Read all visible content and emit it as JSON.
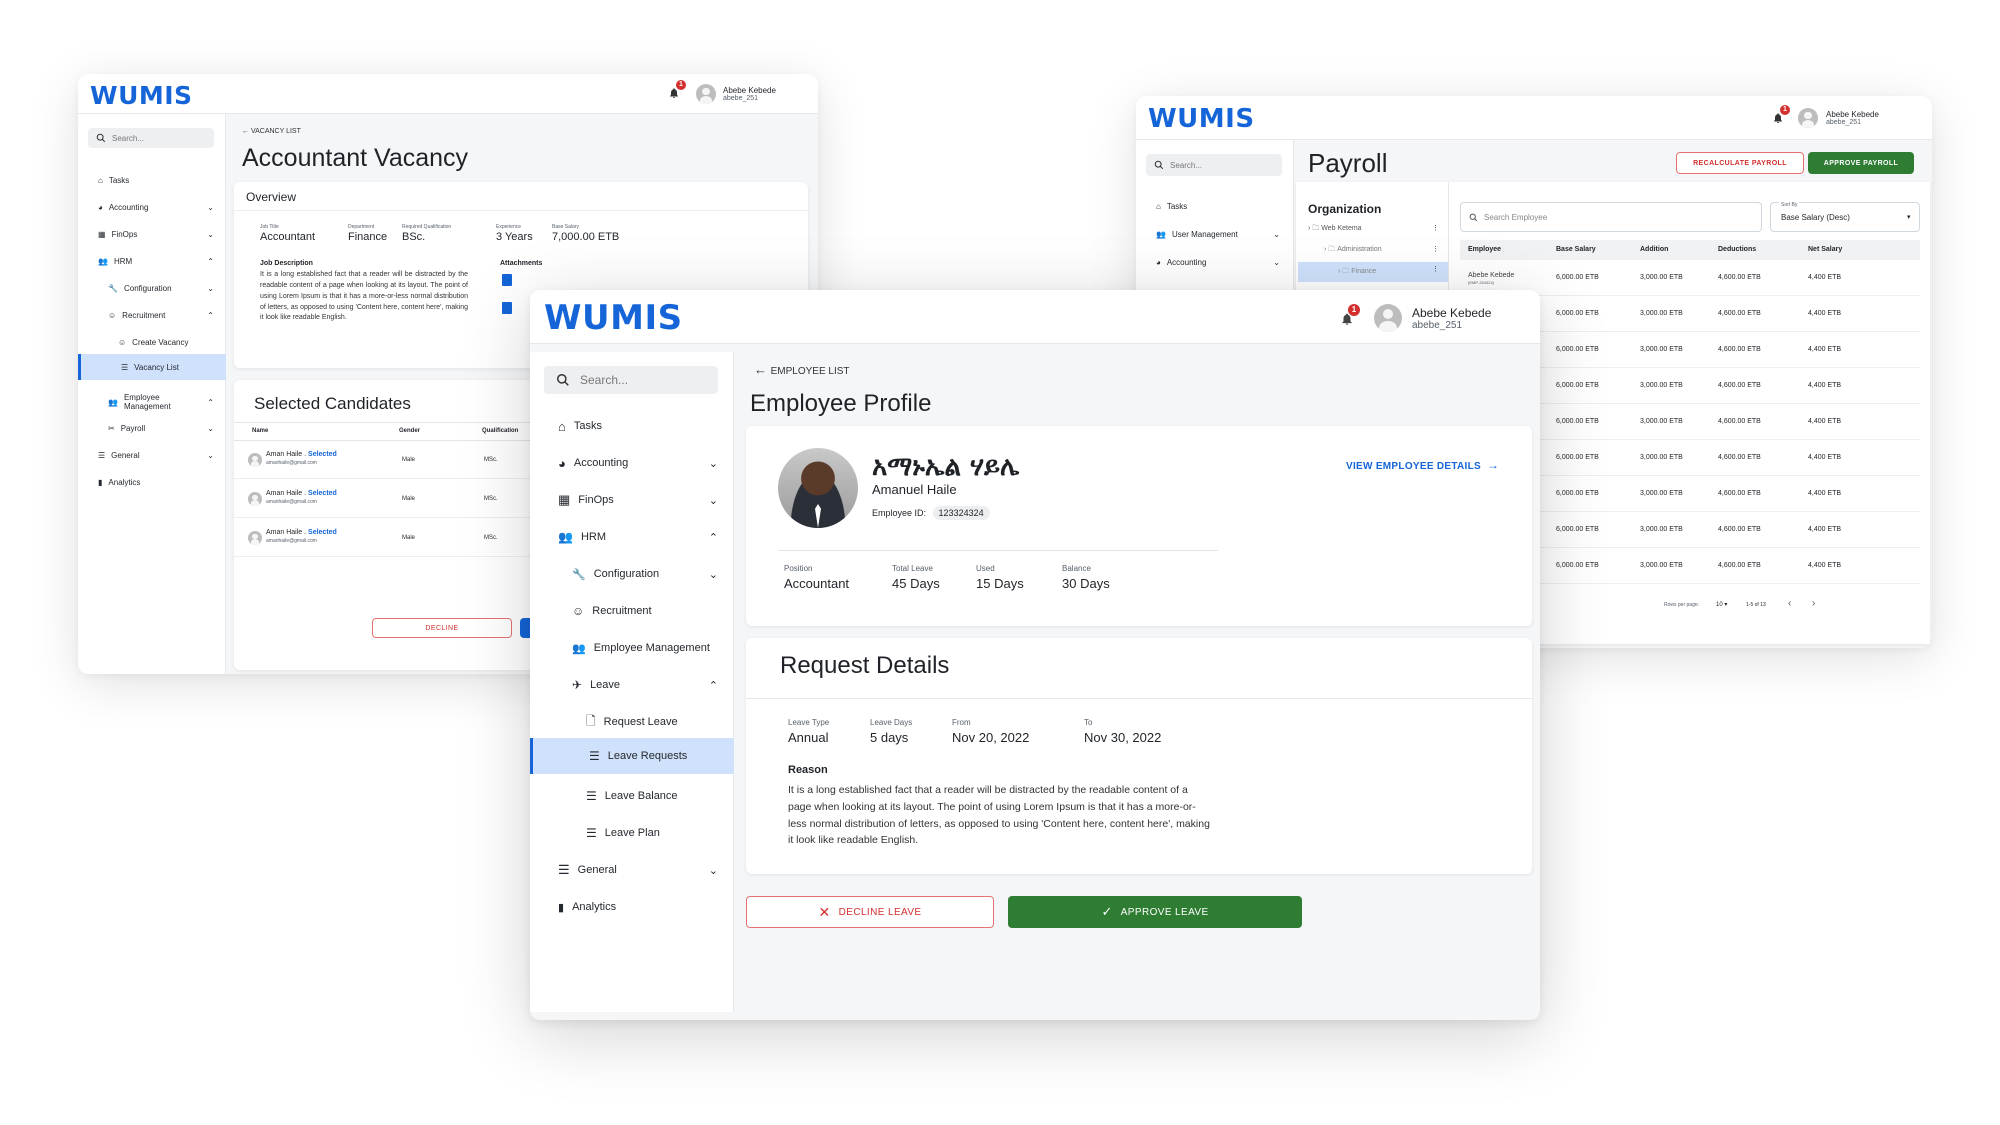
{
  "brand": {
    "logo_text": "WUMIS",
    "color": "#1565d8"
  },
  "user": {
    "name": "Abebe Kebede",
    "username": "abebe_251",
    "notifications": "1"
  },
  "vacancy_window": {
    "search_placeholder": "Search...",
    "nav": [
      {
        "label": "Tasks"
      },
      {
        "label": "Accounting"
      },
      {
        "label": "FinOps"
      },
      {
        "label": "HRM"
      },
      {
        "label": "Configuration"
      },
      {
        "label": "Recruitment"
      },
      {
        "label": "Create Vacancy"
      },
      {
        "label": "Vacancy List"
      },
      {
        "label": "Employee Management"
      },
      {
        "label": "Payroll"
      },
      {
        "label": "General"
      },
      {
        "label": "Analytics"
      }
    ],
    "breadcrumb": "VACANCY LIST",
    "title": "Accountant Vacancy",
    "overview_title": "Overview",
    "fields": [
      {
        "label": "Job Title",
        "value": "Accountant"
      },
      {
        "label": "Department",
        "value": "Finance"
      },
      {
        "label": "Required Qualification",
        "value": "BSc."
      },
      {
        "label": "Experience",
        "value": "3 Years"
      },
      {
        "label": "Base Salary",
        "value": "7,000.00 ETB"
      }
    ],
    "job_description_title": "Job Description",
    "job_description": "It is a long established fact that a reader will be distracted by the readable content of a page when looking at its layout. The point of using Lorem Ipsum is that it has a more-or-less normal distribution of letters, as opposed to using 'Content here, content here', making it look like readable English.",
    "attachments_title": "Attachments",
    "candidates_title": "Selected Candidates",
    "candidates_headers": [
      "Name",
      "Gender",
      "Qualification"
    ],
    "candidates": [
      {
        "name": "Aman Haile",
        "status": "Selected",
        "email": "amanhaile@gmail.com",
        "gender": "Male",
        "qualification": "MSc."
      },
      {
        "name": "Aman Haile",
        "status": "Selected",
        "email": "amanhaile@gmail.com",
        "gender": "Male",
        "qualification": "MSc."
      },
      {
        "name": "Aman Haile",
        "status": "Selected",
        "email": "amanhaile@gmail.com",
        "gender": "Male",
        "qualification": "MSc."
      }
    ],
    "decline_label": "DECLINE"
  },
  "payroll_window": {
    "search_placeholder": "Search...",
    "nav": [
      {
        "label": "Tasks"
      },
      {
        "label": "User Management"
      },
      {
        "label": "Accounting"
      }
    ],
    "title": "Payroll",
    "recalc_label": "RECALCULATE PAYROLL",
    "approve_label": "APPROVE PAYROLL",
    "org_title": "Organization",
    "org_tree": [
      {
        "label": "Web Ketema"
      },
      {
        "label": "Administration"
      },
      {
        "label": "Finance"
      }
    ],
    "search_employee_placeholder": "Search Employee",
    "sort_label": "Sort By",
    "sort_value": "Base Salary (Desc)",
    "headers": [
      "Employee",
      "Base Salary",
      "Addition",
      "Deductions",
      "Net Salary"
    ],
    "first_employee": {
      "name": "Abebe Kebede",
      "id": "(EMP-334324)"
    },
    "rows": [
      {
        "base": "6,000.00 ETB",
        "addition": "3,000.00 ETB",
        "deductions": "4,600.00 ETB",
        "net": "4,400 ETB"
      },
      {
        "base": "6,000.00 ETB",
        "addition": "3,000.00 ETB",
        "deductions": "4,600.00 ETB",
        "net": "4,400 ETB"
      },
      {
        "base": "6,000.00 ETB",
        "addition": "3,000.00 ETB",
        "deductions": "4,600.00 ETB",
        "net": "4,400 ETB"
      },
      {
        "base": "6,000.00 ETB",
        "addition": "3,000.00 ETB",
        "deductions": "4,600.00 ETB",
        "net": "4,400 ETB"
      },
      {
        "base": "6,000.00 ETB",
        "addition": "3,000.00 ETB",
        "deductions": "4,600.00 ETB",
        "net": "4,400 ETB"
      },
      {
        "base": "6,000.00 ETB",
        "addition": "3,000.00 ETB",
        "deductions": "4,600.00 ETB",
        "net": "4,400 ETB"
      },
      {
        "base": "6,000.00 ETB",
        "addition": "3,000.00 ETB",
        "deductions": "4,600.00 ETB",
        "net": "4,400 ETB"
      },
      {
        "base": "6,000.00 ETB",
        "addition": "3,000.00 ETB",
        "deductions": "4,600.00 ETB",
        "net": "4,400 ETB"
      },
      {
        "base": "6,000.00 ETB",
        "addition": "3,000.00 ETB",
        "deductions": "4,600.00 ETB",
        "net": "4,400 ETB"
      }
    ],
    "rows_per_page_label": "Rows per page:",
    "rows_per_page": "10",
    "range": "1-5 of 13"
  },
  "main_window": {
    "search_placeholder": "Search...",
    "nav": [
      {
        "label": "Tasks"
      },
      {
        "label": "Accounting"
      },
      {
        "label": "FinOps"
      },
      {
        "label": "HRM"
      },
      {
        "label": "Configuration"
      },
      {
        "label": "Recruitment"
      },
      {
        "label": "Employee Management"
      },
      {
        "label": "Leave"
      },
      {
        "label": "Request Leave"
      },
      {
        "label": "Leave Requests"
      },
      {
        "label": "Leave Balance"
      },
      {
        "label": "Leave Plan"
      },
      {
        "label": "General"
      },
      {
        "label": "Analytics"
      }
    ],
    "breadcrumb": "EMPLOYEE LIST",
    "title": "Employee Profile",
    "employee": {
      "name_amharic": "አማኑኤል ሃይሌ",
      "name": "Amanuel Haile",
      "id_label": "Employee ID:",
      "id": "123324324",
      "view_details": "VIEW EMPLOYEE DETAILS"
    },
    "stats": [
      {
        "label": "Position",
        "value": "Accountant"
      },
      {
        "label": "Total Leave",
        "value": "45 Days"
      },
      {
        "label": "Used",
        "value": "15 Days"
      },
      {
        "label": "Balance",
        "value": "30 Days"
      }
    ],
    "request_title": "Request Details",
    "request_fields": [
      {
        "label": "Leave Type",
        "value": "Annual"
      },
      {
        "label": "Leave Days",
        "value": "5 days"
      },
      {
        "label": "From",
        "value": "Nov 20, 2022"
      },
      {
        "label": "To",
        "value": "Nov 30, 2022"
      }
    ],
    "reason_title": "Reason",
    "reason": "It is a long established fact that a reader will be distracted by the readable content of a page when looking at its layout. The point of using Lorem Ipsum is that it has a more-or-less normal distribution of letters, as opposed to using 'Content here, content here', making it look like readable English.",
    "decline_label": "DECLINE LEAVE",
    "approve_label": "APPROVE LEAVE"
  },
  "colors": {
    "primary": "#1565d8",
    "success": "#2e7d32",
    "danger": "#d32f2f",
    "active_nav": "#cfe1fb"
  }
}
